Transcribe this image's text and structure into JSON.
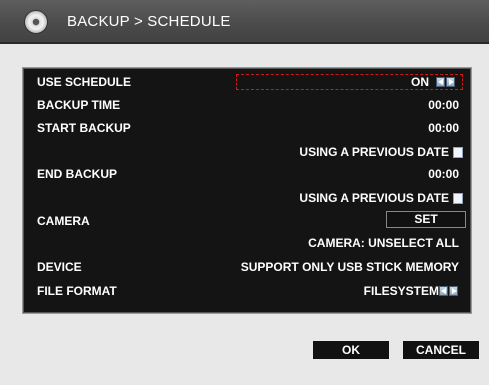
{
  "header": {
    "title": "BACKUP > SCHEDULE",
    "icon": "disc-icon"
  },
  "form": {
    "use_schedule": {
      "label": "USE SCHEDULE",
      "value": "ON"
    },
    "backup_time": {
      "label": "BACKUP TIME",
      "value": "00:00"
    },
    "start_backup": {
      "label": "START BACKUP",
      "value": "00:00",
      "prev_date_label": "USING A PREVIOUS DATE"
    },
    "end_backup": {
      "label": "END BACKUP",
      "value": "00:00",
      "prev_date_label": "USING A PREVIOUS DATE"
    },
    "camera": {
      "label": "CAMERA",
      "button": "SET",
      "status": "CAMERA: UNSELECT ALL"
    },
    "device": {
      "label": "DEVICE",
      "value": "SUPPORT ONLY USB STICK MEMORY"
    },
    "file_format": {
      "label": "FILE FORMAT",
      "value": "FILESYSTEM"
    }
  },
  "footer": {
    "ok_label": "OK",
    "cancel_label": "CANCEL"
  },
  "colors": {
    "panel_bg": "#141414",
    "selection_border": "#d01818",
    "titlebar_bg": "#4a4a4a"
  }
}
